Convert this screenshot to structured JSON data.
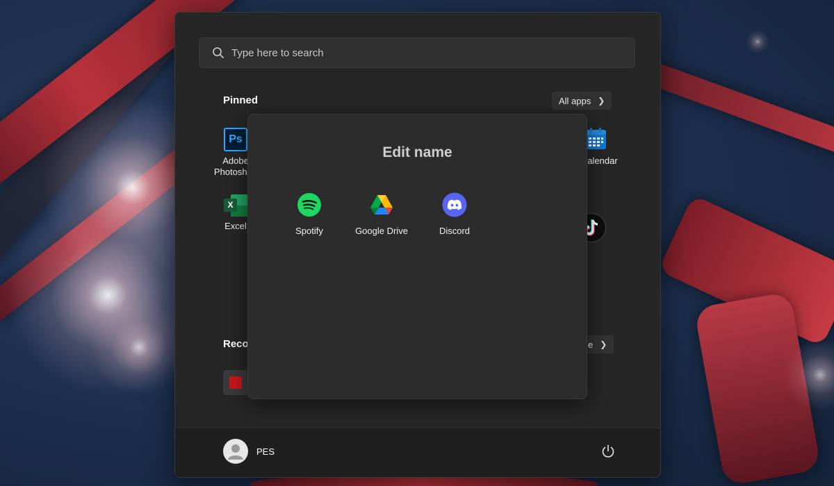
{
  "search": {
    "placeholder": "Type here to search"
  },
  "pinned": {
    "title": "Pinned",
    "all_apps_label": "All apps",
    "apps": [
      {
        "label": "Adobe Photoshop",
        "icon": "photoshop-icon"
      },
      {
        "label": "Excel",
        "icon": "excel-icon"
      },
      {
        "label": "Calendar",
        "icon": "calendar-icon",
        "visible_text": "alendar"
      },
      {
        "label": "TikTok",
        "icon": "tiktok-icon"
      }
    ],
    "photoshop_line1": "Adobe",
    "photoshop_line2": "Photoshop",
    "ps_glyph": "Ps",
    "excel_glyph": "X"
  },
  "recommended": {
    "title_visible": "Reco",
    "more_visible": "e"
  },
  "folder": {
    "title": "Edit name",
    "apps": [
      {
        "label": "Spotify",
        "icon": "spotify-icon"
      },
      {
        "label": "Google Drive",
        "icon": "google-drive-icon"
      },
      {
        "label": "Discord",
        "icon": "discord-icon"
      }
    ]
  },
  "user": {
    "name": "PES"
  },
  "colors": {
    "menu_bg": "#262626",
    "folder_bg": "#2c2c2c",
    "spotify": "#1ed760",
    "discord": "#5865f2",
    "excel": "#107c41",
    "photoshop": "#31a8ff",
    "calendar": "#0f78d4"
  }
}
